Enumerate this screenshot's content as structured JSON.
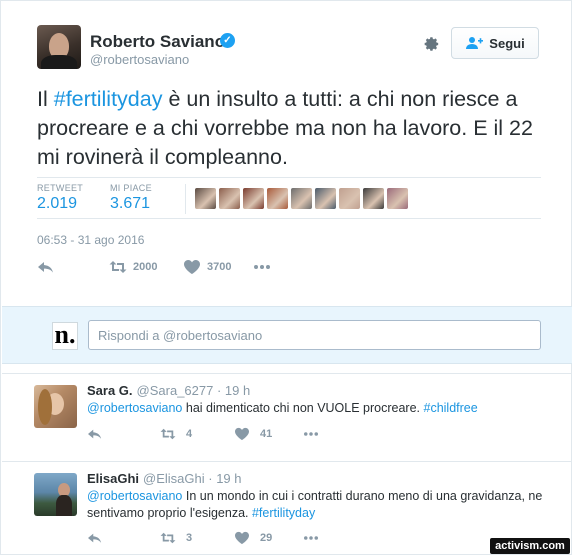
{
  "tweet": {
    "author_name": "Roberto Saviano",
    "author_handle": "@robertosaviano",
    "follow_label": "Segui",
    "text_parts": [
      "Il ",
      "#fertilityday",
      " è un insulto a tutti: a chi non riesce a procreare e a chi vorrebbe ma non ha lavoro. E il 22 mi rovinerà il compleanno."
    ],
    "retweet_label": "RETWEET",
    "retweet_count": "2.019",
    "like_label": "MI PIACE",
    "like_count": "3.671",
    "timestamp": "06:53 - 31 ago 2016",
    "action_retweets": "2000",
    "action_likes": "3700",
    "liker_colors": [
      "#5a4a42",
      "#8b5e4c",
      "#7a3b2e",
      "#a85a3a",
      "#6d6d6d",
      "#4a5a6a",
      "#c0a090",
      "#3a3a3a",
      "#9a6a7a"
    ]
  },
  "composer": {
    "avatar_letter": "n.",
    "placeholder": "Rispondi a @robertosaviano"
  },
  "replies": [
    {
      "name": "Sara G.",
      "handle": "@Sara_6277",
      "time": "· 19 h",
      "mention": "@robertosaviano",
      "text": " hai dimenticato chi non VUOLE procreare. ",
      "tag": "#childfree",
      "retweets": "4",
      "likes": "41"
    },
    {
      "name": "ElisaGhi",
      "handle": "@ElisaGhi",
      "time": "· 19 h",
      "mention": "@robertosaviano",
      "text": " In un mondo in cui i contratti durano meno di una gravidanza, ne sentivamo proprio l'esigenza. ",
      "tag": "#fertilityday",
      "retweets": "3",
      "likes": "29"
    }
  ],
  "watermark": "activism.com",
  "colors": {
    "accent": "#1b95e0",
    "muted": "#8899a6",
    "text": "#292f33",
    "composer_bg": "#e8f5fd"
  }
}
